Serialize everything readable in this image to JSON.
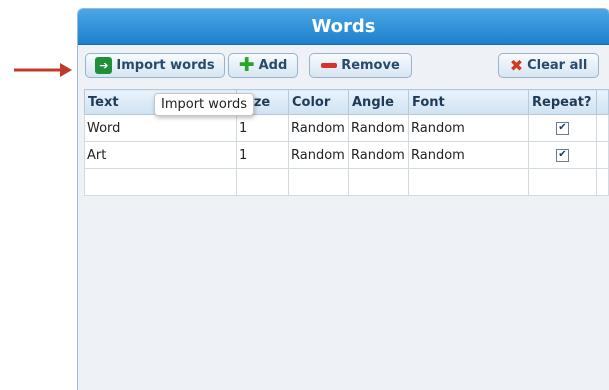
{
  "panel": {
    "title": "Words"
  },
  "toolbar": {
    "import_label": "Import words",
    "add_label": "Add",
    "remove_label": "Remove",
    "clear_label": "Clear all"
  },
  "tooltip": {
    "text": "Import words"
  },
  "table": {
    "columns": [
      "Text",
      "Size",
      "Color",
      "Angle",
      "Font",
      "Repeat?"
    ],
    "rows": [
      {
        "text": "Word",
        "size": "1",
        "color": "Random",
        "angle": "Random",
        "font": "Random",
        "repeat": true
      },
      {
        "text": "Art",
        "size": "1",
        "color": "Random",
        "angle": "Random",
        "font": "Random",
        "repeat": true
      }
    ]
  },
  "icons": {
    "arrow": "red-arrow-icon",
    "import": "import-icon",
    "add": "plus-icon",
    "remove": "minus-icon",
    "clear": "x-icon",
    "checkbox": "checkmark-icon"
  },
  "colors": {
    "title_bar": "#2a8fd8",
    "arrow": "#c0392b"
  }
}
